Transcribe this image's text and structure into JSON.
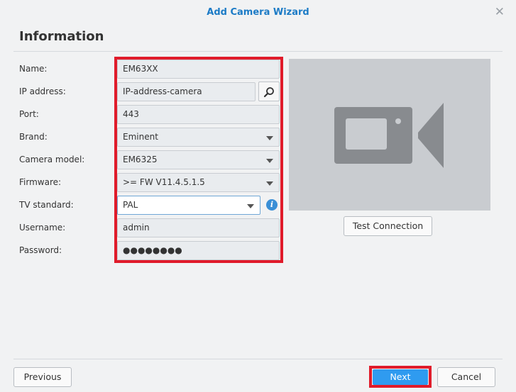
{
  "window": {
    "title": "Add Camera Wizard"
  },
  "section": {
    "title": "Information"
  },
  "form": {
    "name": {
      "label": "Name:",
      "value": "EM63XX"
    },
    "ip": {
      "label": "IP address:",
      "value": "IP-address-camera"
    },
    "port": {
      "label": "Port:",
      "value": "443"
    },
    "brand": {
      "label": "Brand:",
      "value": "Eminent"
    },
    "model": {
      "label": "Camera model:",
      "value": "EM6325"
    },
    "firmware": {
      "label": "Firmware:",
      "value": ">= FW V11.4.5.1.5"
    },
    "tv_standard": {
      "label": "TV standard:",
      "value": "PAL"
    },
    "username": {
      "label": "Username:",
      "value": "admin"
    },
    "password": {
      "label": "Password:",
      "value": "●●●●●●●●"
    }
  },
  "buttons": {
    "test_connection": "Test Connection",
    "previous": "Previous",
    "next": "Next",
    "cancel": "Cancel"
  },
  "icons": {
    "close": "close-icon",
    "search": "search-icon",
    "info": "info-icon",
    "camera": "video-camera-icon"
  },
  "colors": {
    "accent": "#1c7bc6",
    "highlight": "#e01b2a",
    "primary_button": "#2f9bf0"
  }
}
